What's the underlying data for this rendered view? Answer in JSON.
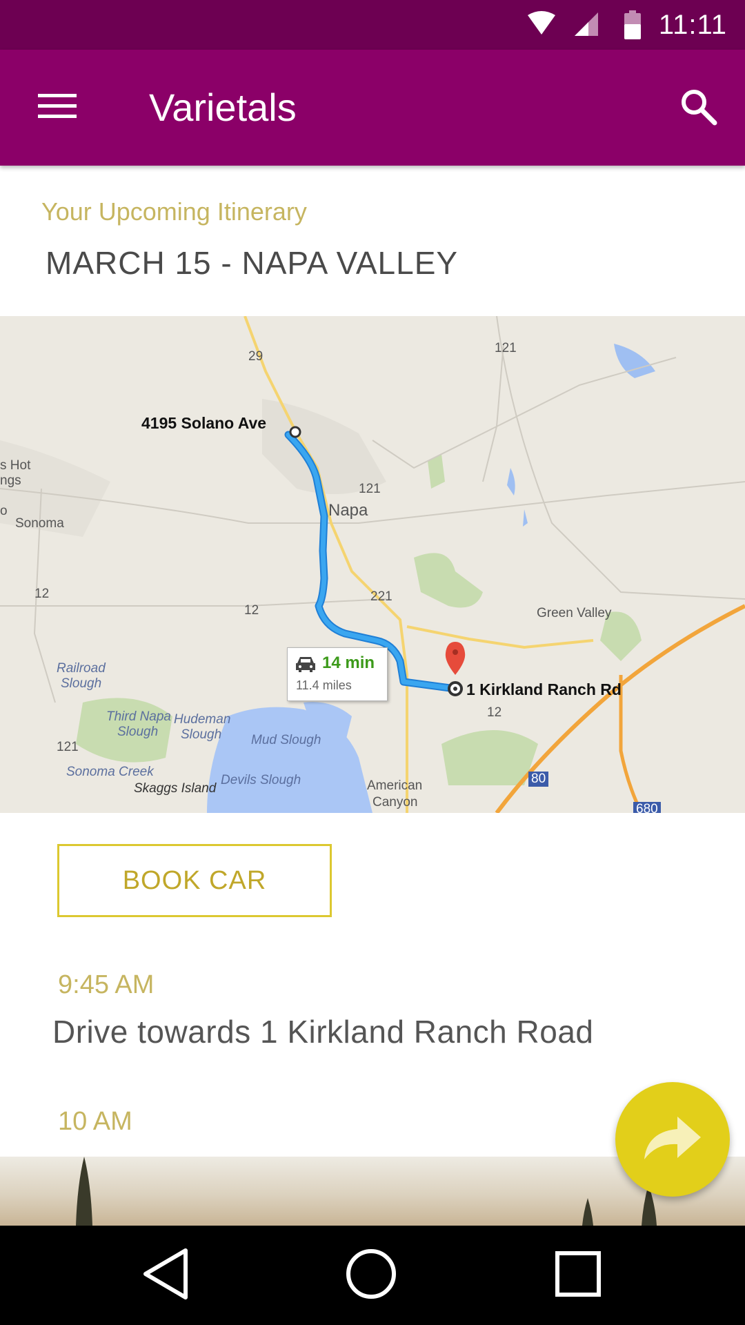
{
  "status_bar": {
    "time": "11:11",
    "icons": [
      "wifi-icon",
      "cell-signal-icon",
      "battery-icon"
    ]
  },
  "app_bar": {
    "title": "Varietals",
    "menu_icon": "hamburger-menu-icon",
    "search_icon": "search-icon",
    "background": "#8b0068"
  },
  "itinerary": {
    "kicker": "Your Upcoming Itinerary",
    "title": "MARCH 15 - NAPA VALLEY"
  },
  "map": {
    "origin": "4195 Solano Ave",
    "destination": "1 Kirkland Ranch Rd",
    "route_time": "14 min",
    "route_distance": "11.4 miles",
    "labels": {
      "napa": "Napa",
      "sonoma": "Sonoma",
      "hot": "s Hot",
      "ngs": "ngs",
      "o": "o",
      "green_valley": "Green Valley",
      "railroad_slough_1": "Railroad",
      "railroad_slough_2": "Slough",
      "third_napa_1": "Third Napa",
      "third_napa_2": "Slough",
      "hudeman_1": "Hudeman",
      "hudeman_2": "Slough",
      "mud_slough": "Mud Slough",
      "sonoma_creek": "Sonoma Creek",
      "skaggs_island": "Skaggs Island",
      "devils_slough": "Devils Slough",
      "american_1": "American",
      "american_2": "Canyon"
    },
    "shields": {
      "r29": "29",
      "r121_a": "121",
      "r121_b": "121",
      "r121_c": "121",
      "r12_a": "12",
      "r12_b": "12",
      "r12_c": "12",
      "r221": "221",
      "i80": "80",
      "i680": "680"
    }
  },
  "book_car": {
    "label": "BOOK CAR"
  },
  "timeline": [
    {
      "time": "9:45 AM",
      "event": "Drive towards 1 Kirkland Ranch Road"
    },
    {
      "time": "10 AM"
    }
  ],
  "fab": {
    "icon": "share-forward-icon",
    "color": "#e2cf1a"
  },
  "nav_bar": {
    "icons": [
      "back-icon",
      "home-icon",
      "recents-icon"
    ]
  }
}
